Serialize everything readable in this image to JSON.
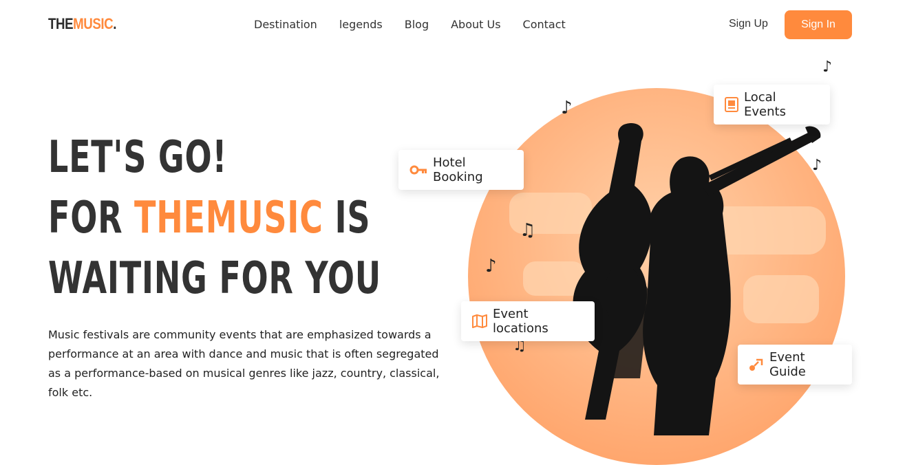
{
  "brand": {
    "part1": "THE",
    "part2": "MUSIC",
    "part3": "."
  },
  "nav": {
    "items": [
      "Destination",
      "legends",
      "Blog",
      "About Us",
      "Contact"
    ]
  },
  "auth": {
    "signup": "Sign Up",
    "signin": "Sign In"
  },
  "hero": {
    "line1": "LET'S GO!",
    "line2_pre": "FOR ",
    "line2_accent": "THEMUSIC",
    "line2_post": " IS",
    "line3": "WAITING FOR YOU",
    "description": "Music festivals are community events that are emphasized towards a performance at an area with dance and music that is often segregated as a performance-based on musical genres like jazz, country, classical, folk etc."
  },
  "cards": {
    "local_events": "Local Events",
    "hotel_booking": "Hotel Booking",
    "event_locations": "Event locations",
    "event_guide": "Event Guide"
  },
  "colors": {
    "accent": "#ff8a3d",
    "text": "#333333"
  }
}
